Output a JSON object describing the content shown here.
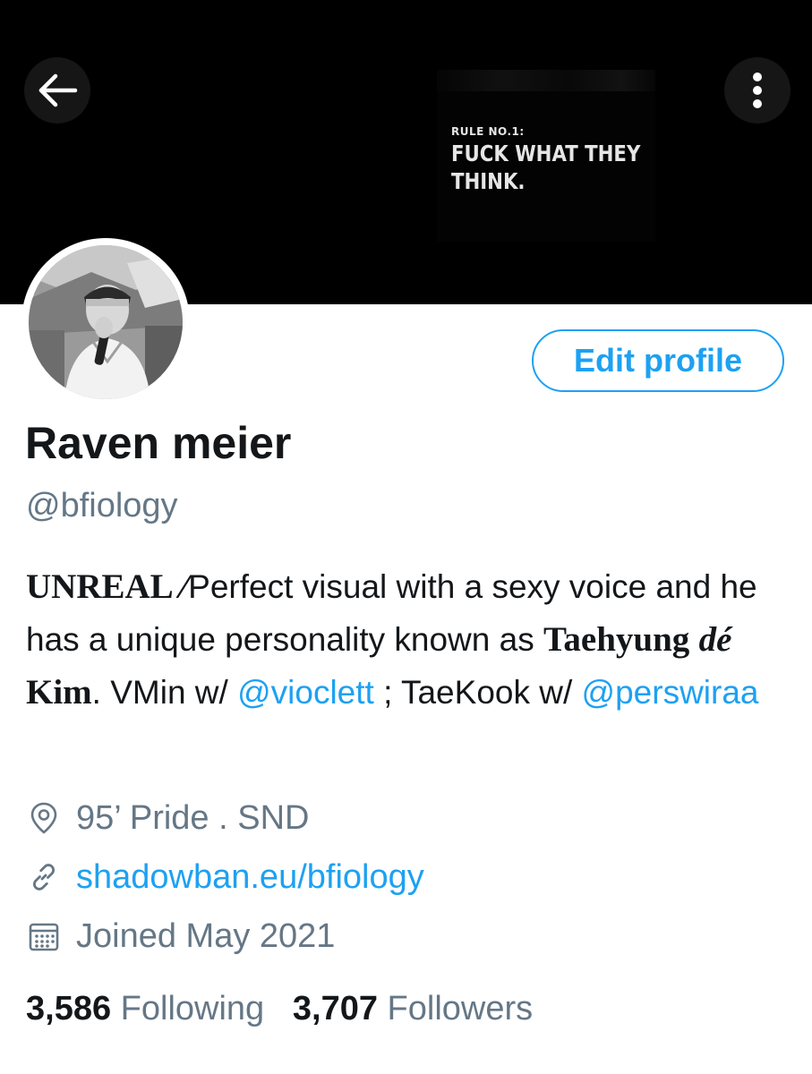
{
  "header": {
    "back_icon": "arrow-left-icon",
    "more_icon": "more-vertical-icon"
  },
  "banner": {
    "line1": "RULE NO.1:",
    "line2": "FUCK WHAT THEY",
    "line3": "THINK."
  },
  "profile": {
    "edit_button_label": "Edit profile",
    "name": "Raven meier",
    "handle": "@bfiology"
  },
  "bio": {
    "part1_bold": "UNREAL",
    "part2": " ⁄Perfect visual with a sexy voice and he has a unique personality known as ",
    "part3_bold": "Taehyung",
    "part4_bold_italic": "dé",
    "part5_bold": "Kim",
    "part6": ". VMin w/ ",
    "mention1": "@vioclett",
    "part7": " ; TaeKook w/ ",
    "mention2": "@perswiraa"
  },
  "meta": {
    "location": "95’ Pride . SND",
    "location_icon": "location-pin-icon",
    "website": "shadowban.eu/bfiology",
    "website_icon": "link-icon",
    "joined": "Joined May 2021",
    "joined_icon": "calendar-icon"
  },
  "stats": {
    "following_count": "3,586",
    "following_label": "Following",
    "followers_count": "3,707",
    "followers_label": "Followers"
  },
  "colors": {
    "accent": "#1da1f2",
    "secondary_text": "#657786",
    "primary_text": "#14171a",
    "banner_bg": "#000000"
  }
}
